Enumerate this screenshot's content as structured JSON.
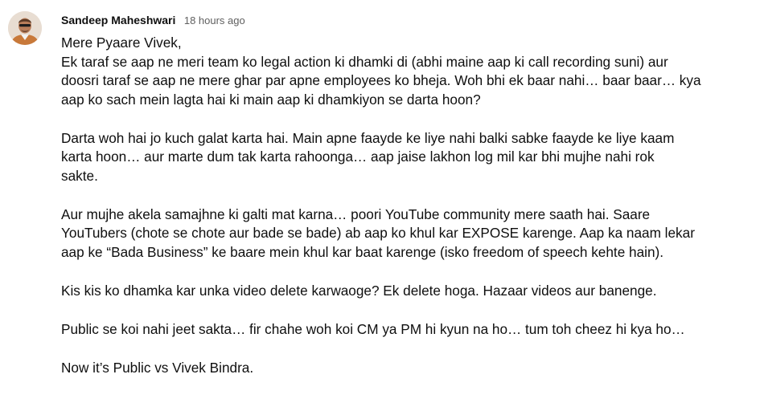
{
  "comment": {
    "author": "Sandeep Maheshwari",
    "timestamp": "18 hours ago",
    "avatar_icon": "user-avatar-icon",
    "paragraphs": [
      [
        "Mere Pyaare Vivek,",
        "Ek taraf se aap ne meri team ko legal action ki dhamki di (abhi maine aap ki call recording suni) aur",
        "doosri taraf se aap ne mere ghar par apne employees ko bheja. Woh bhi ek baar nahi… baar baar… kya",
        "aap ko sach mein lagta hai ki main aap ki dhamkiyon se darta hoon?"
      ],
      [
        "Darta woh hai jo kuch galat karta hai. Main apne faayde ke liye nahi balki sabke faayde ke liye kaam",
        "karta hoon… aur marte dum tak karta rahoonga… aap jaise lakhon log mil kar bhi mujhe nahi rok",
        "sakte."
      ],
      [
        "Aur mujhe akela samajhne ki galti mat karna… poori YouTube community mere saath hai. Saare",
        "YouTubers (chote se chote aur bade se bade) ab aap ko khul kar EXPOSE karenge. Aap ka naam lekar",
        "aap ke “Bada Business” ke baare mein khul kar baat karenge (isko freedom of speech kehte hain)."
      ],
      [
        "Kis kis ko dhamka kar unka video delete karwaoge? Ek delete hoga. Hazaar videos aur banenge."
      ],
      [
        "Public se koi nahi jeet sakta… fir chahe woh koi CM ya PM hi kyun na ho… tum toh cheez hi kya ho…"
      ],
      [
        "Now it’s Public vs Vivek Bindra."
      ]
    ]
  }
}
